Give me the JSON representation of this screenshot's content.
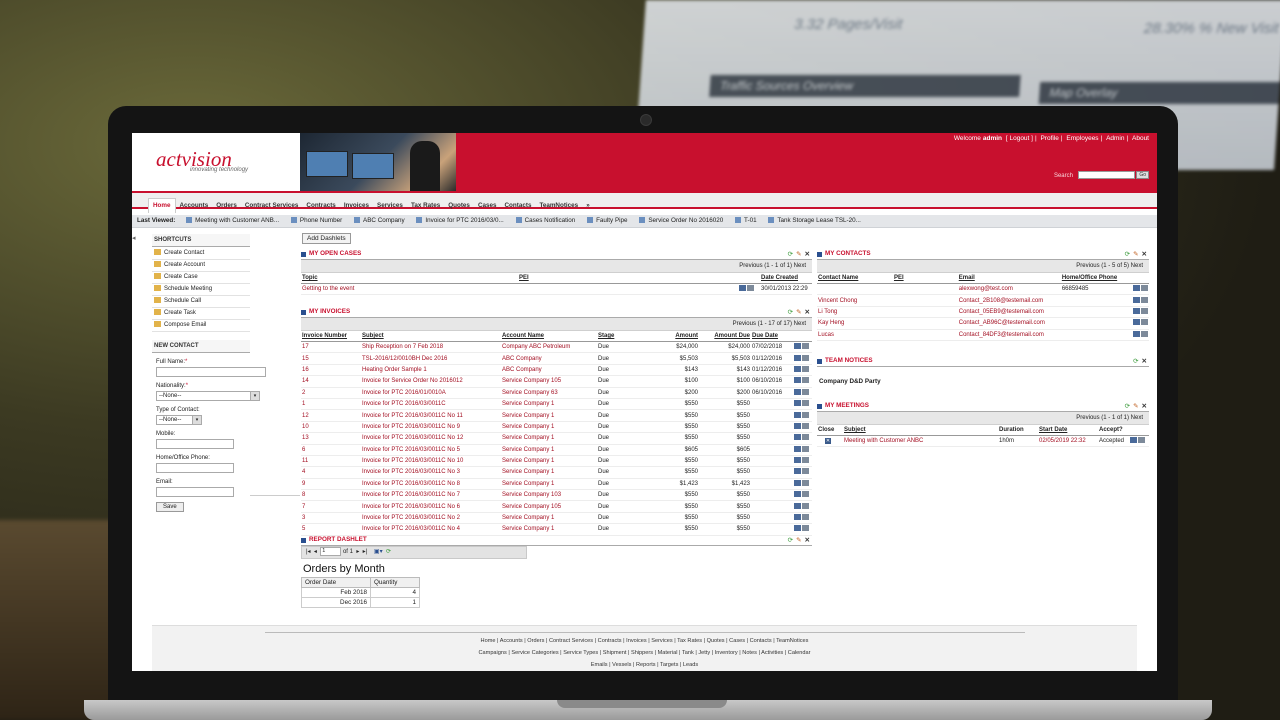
{
  "background": {
    "stats": [
      "3.32 Pages/Visit",
      "28.30% % New Visit"
    ],
    "bars": [
      "Traffic Sources Overview",
      "Map Overlay"
    ]
  },
  "header": {
    "logo_text": "actvision",
    "logo_tag": "innovating technology",
    "welcome_prefix": "Welcome",
    "user": "admin",
    "links": [
      "[ Logout ]",
      "Profile",
      "Employees",
      "Admin",
      "About"
    ],
    "search_label": "Search",
    "search_button": "Go"
  },
  "nav": {
    "tabs": [
      "Home",
      "Accounts",
      "Orders",
      "Contract Services",
      "Contracts",
      "Invoices",
      "Services",
      "Tax Rates",
      "Quotes",
      "Cases",
      "Contacts",
      "TeamNotices",
      "»"
    ]
  },
  "last_viewed": {
    "label": "Last Viewed:",
    "items": [
      "Meeting with Customer ANB...",
      "Phone Number",
      "ABC Company",
      "Invoice for PTC 2016/03/0...",
      "Cases Notification",
      "Faulty Pipe",
      "Service Order No 2016020",
      "T-01",
      "Tank Storage Lease TSL-20..."
    ]
  },
  "sidebar": {
    "shortcuts_title": "SHORTCUTS",
    "shortcuts": [
      "Create Contact",
      "Create Account",
      "Create Case",
      "Schedule Meeting",
      "Schedule Call",
      "Create Task",
      "Compose Email"
    ],
    "new_contact_title": "NEW CONTACT",
    "full_name_label": "Full Name:",
    "nationality_label": "Nationality:",
    "nationality_value": "--None--",
    "type_label": "Type of Contact:",
    "type_value": "--None--",
    "mobile_label": "Mobile:",
    "home_phone_label": "Home/Office Phone:",
    "email_label": "Email:",
    "save_label": "Save"
  },
  "add_dashlets_label": "Add Dashlets",
  "open_cases": {
    "title": "MY OPEN CASES",
    "pager": "Previous  (1 - 1 of 1)  Next",
    "headers": [
      "Topic",
      "PEI",
      "Date Created"
    ],
    "rows": [
      [
        "Getting to the event",
        "",
        "30/01/2013 22:29"
      ]
    ]
  },
  "invoices": {
    "title": "MY INVOICES",
    "pager": "Previous  (1 - 17 of 17)  Next",
    "headers": [
      "Invoice Number",
      "Subject",
      "Account Name",
      "Stage",
      "Amount",
      "Amount Due",
      "Due Date"
    ],
    "rows": [
      [
        "17",
        "Ship Reception on 7 Feb 2018",
        "Company ABC Petroleum",
        "Due",
        "$24,000",
        "$24,000",
        "07/02/2018"
      ],
      [
        "15",
        "TSL-2016/12/0010BH Dec 2016",
        "ABC Company",
        "Due",
        "$5,503",
        "$5,503",
        "01/12/2016"
      ],
      [
        "16",
        "Heating Order Sample 1",
        "ABC Company",
        "Due",
        "$143",
        "$143",
        "01/12/2016"
      ],
      [
        "14",
        "Invoice for Service Order No 2016012",
        "Service Company 105",
        "Due",
        "$100",
        "$100",
        "06/10/2016"
      ],
      [
        "2",
        "Invoice for PTC 2016/01/0010A",
        "Service Company 63",
        "Due",
        "$200",
        "$200",
        "06/10/2016"
      ],
      [
        "1",
        "Invoice for PTC 2016/03/0011C",
        "Service Company 1",
        "Due",
        "$550",
        "$550",
        ""
      ],
      [
        "12",
        "Invoice for PTC 2016/03/0011C No 11",
        "Service Company 1",
        "Due",
        "$550",
        "$550",
        ""
      ],
      [
        "10",
        "Invoice for PTC 2016/03/0011C No 9",
        "Service Company 1",
        "Due",
        "$550",
        "$550",
        ""
      ],
      [
        "13",
        "Invoice for PTC 2016/03/0011C No 12",
        "Service Company 1",
        "Due",
        "$550",
        "$550",
        ""
      ],
      [
        "6",
        "Invoice for PTC 2016/03/0011C No 5",
        "Service Company 1",
        "Due",
        "$605",
        "$605",
        ""
      ],
      [
        "11",
        "Invoice for PTC 2016/03/0011C No 10",
        "Service Company 1",
        "Due",
        "$550",
        "$550",
        ""
      ],
      [
        "4",
        "Invoice for PTC 2016/03/0011C No 3",
        "Service Company 1",
        "Due",
        "$550",
        "$550",
        ""
      ],
      [
        "9",
        "Invoice for PTC 2016/03/0011C No 8",
        "Service Company 1",
        "Due",
        "$1,423",
        "$1,423",
        ""
      ],
      [
        "8",
        "Invoice for PTC 2016/03/0011C No 7",
        "Service Company 103",
        "Due",
        "$550",
        "$550",
        ""
      ],
      [
        "7",
        "Invoice for PTC 2016/03/0011C No 6",
        "Service Company 105",
        "Due",
        "$550",
        "$550",
        ""
      ],
      [
        "3",
        "Invoice for PTC 2016/03/0011C No 2",
        "Service Company 1",
        "Due",
        "$550",
        "$550",
        ""
      ],
      [
        "5",
        "Invoice for PTC 2016/03/0011C No 4",
        "Service Company 1",
        "Due",
        "$550",
        "$550",
        ""
      ]
    ]
  },
  "report": {
    "title": "REPORT DASHLET",
    "page_value": "1",
    "of_text": "of 1",
    "chart_title": "Orders by Month",
    "headers": [
      "Order Date",
      "Quantity"
    ],
    "rows": [
      [
        "Feb 2018",
        "4"
      ],
      [
        "Dec 2016",
        "1"
      ]
    ]
  },
  "contacts": {
    "title": "MY CONTACTS",
    "pager": "Previous  (1 - 5 of 5)  Next",
    "headers": [
      "Contact Name",
      "PEI",
      "Email",
      "Home/Office Phone"
    ],
    "rows": [
      [
        "",
        "",
        "alexwong@test.com",
        "66859485"
      ],
      [
        "Vincent Chong",
        "",
        "Contact_2B108@testemail.com",
        ""
      ],
      [
        "Li Tong",
        "",
        "Contact_05EB9@testemail.com",
        ""
      ],
      [
        "Kay Heng",
        "",
        "Contact_AB96C@testemail.com",
        ""
      ],
      [
        "Lucas",
        "",
        "Contact_84DF3@testemail.com",
        ""
      ]
    ]
  },
  "team_notices": {
    "title": "TEAM NOTICES",
    "item": "Company D&D Party"
  },
  "meetings": {
    "title": "MY MEETINGS",
    "pager": "Previous  (1 - 1 of 1)  Next",
    "headers": [
      "Close",
      "Subject",
      "Duration",
      "Start Date",
      "Accept?"
    ],
    "rows": [
      [
        "",
        "Meeting with Customer ANBC",
        "1h0m",
        "02/05/2019 22:32",
        "Accepted"
      ]
    ]
  },
  "footer": {
    "line1": "Home | Accounts | Orders | Contract Services | Contracts | Invoices | Services | Tax Rates | Quotes | Cases | Contacts | TeamNotices",
    "line2": "Campaigns | Service Categories | Service Types | Shipment | Shippers | Material | Tank | Jetty | Inventory | Notes | Activities | Calendar",
    "line3": "Emails | Vessels | Reports | Targets | Leads"
  },
  "colors": {
    "brand": "#c8102e",
    "link_red": "#a30f22",
    "nav_bg": "#efefef"
  }
}
